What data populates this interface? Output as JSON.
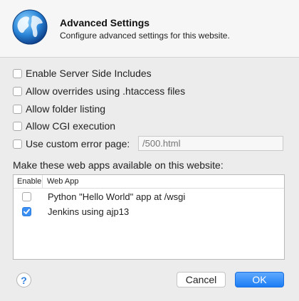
{
  "dialog": {
    "title": "Advanced Settings",
    "subtitle": "Configure advanced settings for this website.",
    "icon": "globe-icon"
  },
  "options": [
    {
      "label": "Enable Server Side Includes",
      "checked": false
    },
    {
      "label": "Allow overrides using .htaccess files",
      "checked": false
    },
    {
      "label": "Allow folder listing",
      "checked": false
    },
    {
      "label": "Allow CGI execution",
      "checked": false
    },
    {
      "label": "Use custom error page:",
      "checked": false
    }
  ],
  "error_page": {
    "placeholder": "/500.html",
    "value": ""
  },
  "webapps": {
    "label": "Make these web apps available on this website:",
    "columns": [
      "Enable",
      "Web App"
    ],
    "rows": [
      {
        "label": "Python \"Hello World\" app at /wsgi",
        "enabled": false
      },
      {
        "label": "Jenkins using ajp13",
        "enabled": true
      }
    ]
  },
  "footer": {
    "help_label": "?",
    "cancel_label": "Cancel",
    "ok_label": "OK"
  },
  "colors": {
    "accent": "#3b8ff3",
    "background": "#ececec"
  }
}
